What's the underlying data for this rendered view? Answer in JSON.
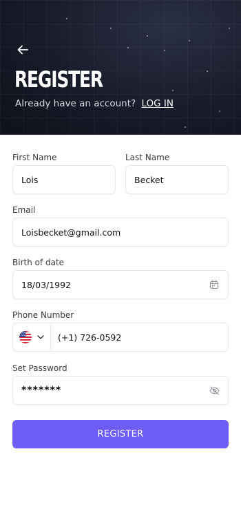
{
  "header": {
    "title": "REGISTER",
    "subtitle": "Already have an account?",
    "login_link": "LOG IN",
    "back_icon": "arrow-left-icon"
  },
  "form": {
    "first_name": {
      "label": "First Name",
      "value": "Lois"
    },
    "last_name": {
      "label": "Last Name",
      "value": "Becket"
    },
    "email": {
      "label": "Email",
      "value": "Loisbecket@gmail.com"
    },
    "birth_date": {
      "label": "Birth of date",
      "value": "18/03/1992",
      "icon": "calendar-icon"
    },
    "phone": {
      "label": "Phone Number",
      "value": "(+1) 726-0592",
      "country_flag": "us-flag-icon",
      "dropdown_icon": "chevron-down-icon"
    },
    "password": {
      "label": "Set Password",
      "value": "*******",
      "icon": "eye-off-icon"
    }
  },
  "actions": {
    "register_label": "REGISTER"
  },
  "colors": {
    "accent": "#6d5cf6",
    "hero_bg": "#181b29",
    "field_border": "#e8e9ee"
  }
}
